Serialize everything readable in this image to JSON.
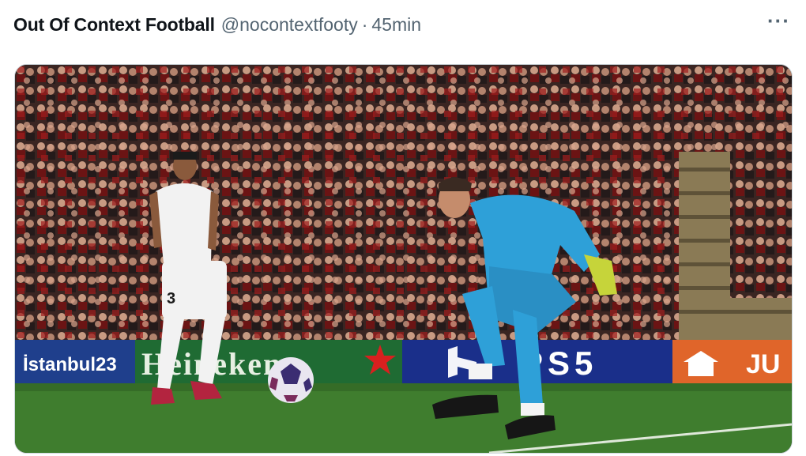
{
  "tweet": {
    "author_name": "Out Of Context Football",
    "handle": "@nocontextfooty",
    "separator": "·",
    "time": "45min",
    "more_label": "···"
  },
  "media": {
    "boards": [
      {
        "text": "İstanbul23",
        "bg": "#1f3f8c",
        "fg": "#ffffff"
      },
      {
        "text": "Heineken",
        "bg": "#1f6b33",
        "fg": "#e6efe2"
      },
      {
        "text": "PS5",
        "bg": "#1a2f8a",
        "fg": "#ffffff"
      },
      {
        "text": "JU",
        "bg": "#e0652a",
        "fg": "#ffffff"
      }
    ],
    "outfield_player_number": "3",
    "colors": {
      "crowd": "#3a2522",
      "pitch": "#3f7d2e",
      "keeper_kit": "#2ea0d8",
      "white_kit": "#f2f2f2"
    }
  }
}
